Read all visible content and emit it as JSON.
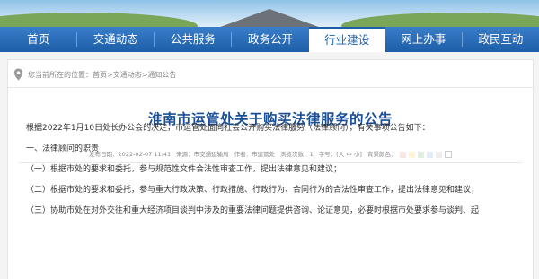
{
  "nav": {
    "items": [
      {
        "label": "首页"
      },
      {
        "label": "交通动态"
      },
      {
        "label": "公共服务"
      },
      {
        "label": "政务公开"
      },
      {
        "label": "行业建设"
      },
      {
        "label": "网上办事"
      },
      {
        "label": "政民互动"
      }
    ],
    "active_index": 4
  },
  "breadcrumb": {
    "prefix": "您当前所在的位置：",
    "items": [
      "首页",
      "交通动态",
      "通知公告"
    ],
    "separator": " > "
  },
  "article": {
    "title": "淮南市运管处关于购买法律服务的公告",
    "meta": {
      "date": "发布日期：2022-02-07 11:41",
      "source": "来源：市交通运输局",
      "author": "作者：市运管处",
      "views": "浏览次数：1",
      "font_size": "字号：[大 中 小]",
      "bg_color": "背景颜色："
    },
    "swatches": [
      "#fbe4e4",
      "#fff5d6",
      "#e0f0e0",
      "#e2ecf8",
      "#eeeeee",
      "#ffffff"
    ],
    "paragraphs": [
      "根据2022年1月10日处长办公会的决定，市运管处面向社会公开购买法律服务（法律顾问），有关事项公告如下：",
      "一、法律顾问的职责",
      "（一）根据市处的要求和委托，参与规范性文件合法性审查工作，提出法律意见和建议；",
      "（二）根据市处的要求和委托，参与重大行政决策、行政措施、行政行为、合同行为的合法性审查工作，提出法律意见和建议；",
      "（三）协助市处在对外交往和重大经济项目谈判中涉及的重要法律问题提供咨询、论证意见，必要时根据市处要求参与谈判、起"
    ]
  }
}
